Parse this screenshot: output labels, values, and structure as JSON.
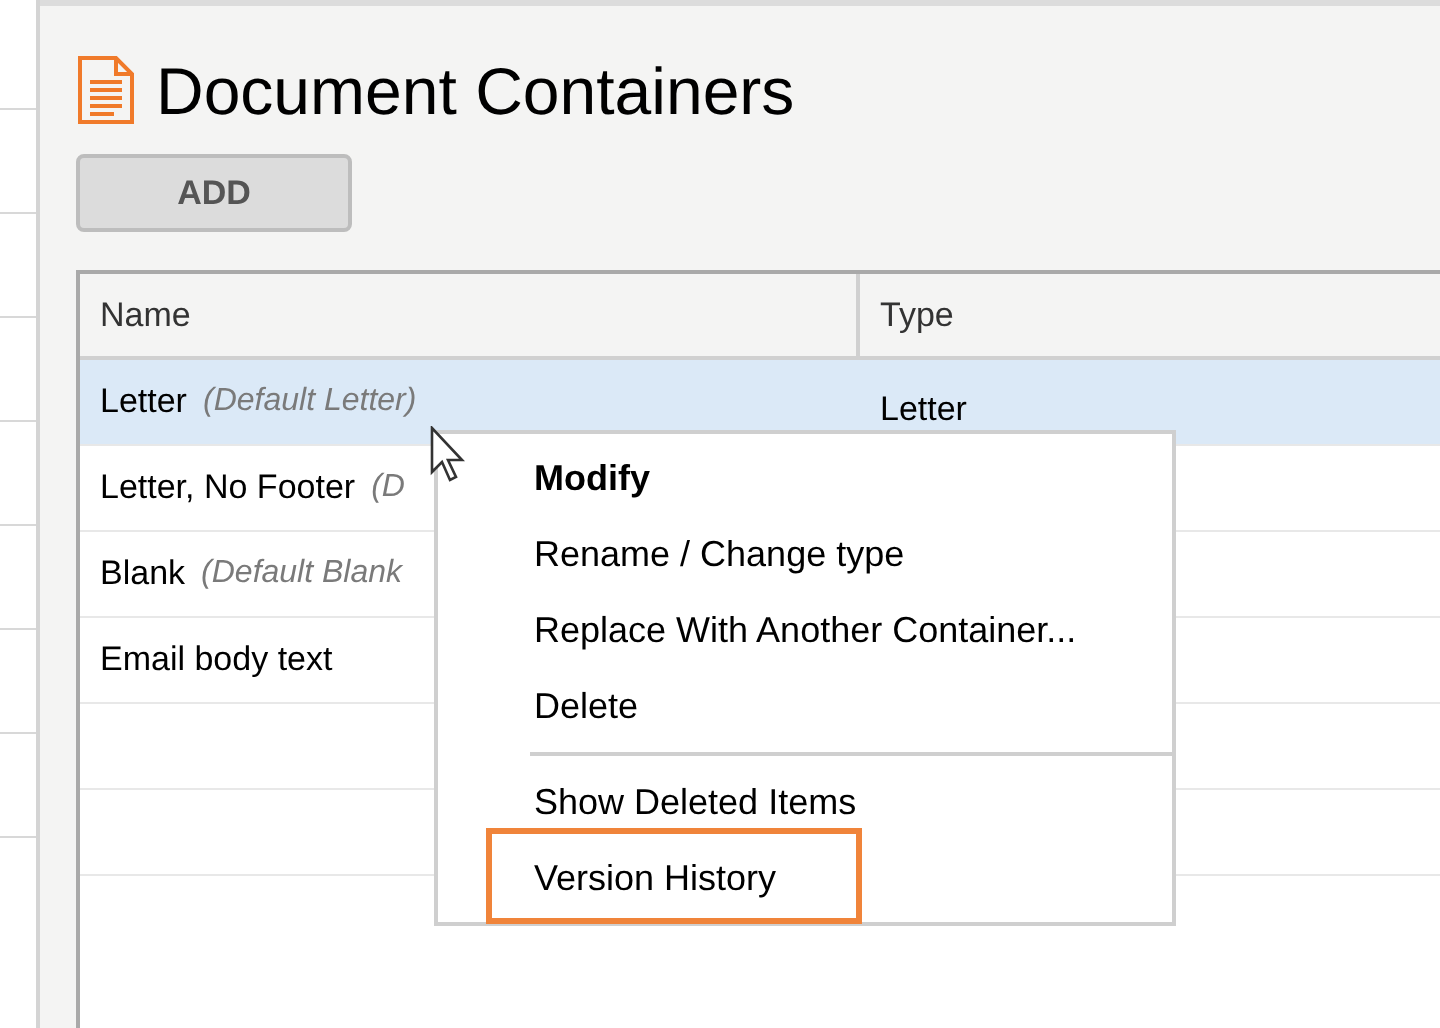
{
  "page": {
    "title": "Document Containers",
    "add_button": "ADD"
  },
  "table": {
    "columns": [
      "Name",
      "Type"
    ],
    "rows": [
      {
        "name": "Letter",
        "note": "(Default Letter)",
        "type": "Letter",
        "selected": true
      },
      {
        "name": "Letter, No Footer",
        "note": "(D",
        "type": "",
        "selected": false
      },
      {
        "name": "Blank",
        "note": "(Default Blank",
        "type": "",
        "selected": false
      },
      {
        "name": "Email body text",
        "note": "",
        "type": "",
        "selected": false
      }
    ]
  },
  "context_menu": {
    "groups": [
      [
        {
          "label": "Modify",
          "default": true,
          "highlighted": false
        },
        {
          "label": "Rename / Change type",
          "default": false,
          "highlighted": false
        },
        {
          "label": "Replace With Another Container...",
          "default": false,
          "highlighted": false
        },
        {
          "label": "Delete",
          "default": false,
          "highlighted": false
        }
      ],
      [
        {
          "label": "Show Deleted Items",
          "default": false,
          "highlighted": false
        },
        {
          "label": "Version History",
          "default": false,
          "highlighted": true
        }
      ]
    ]
  }
}
